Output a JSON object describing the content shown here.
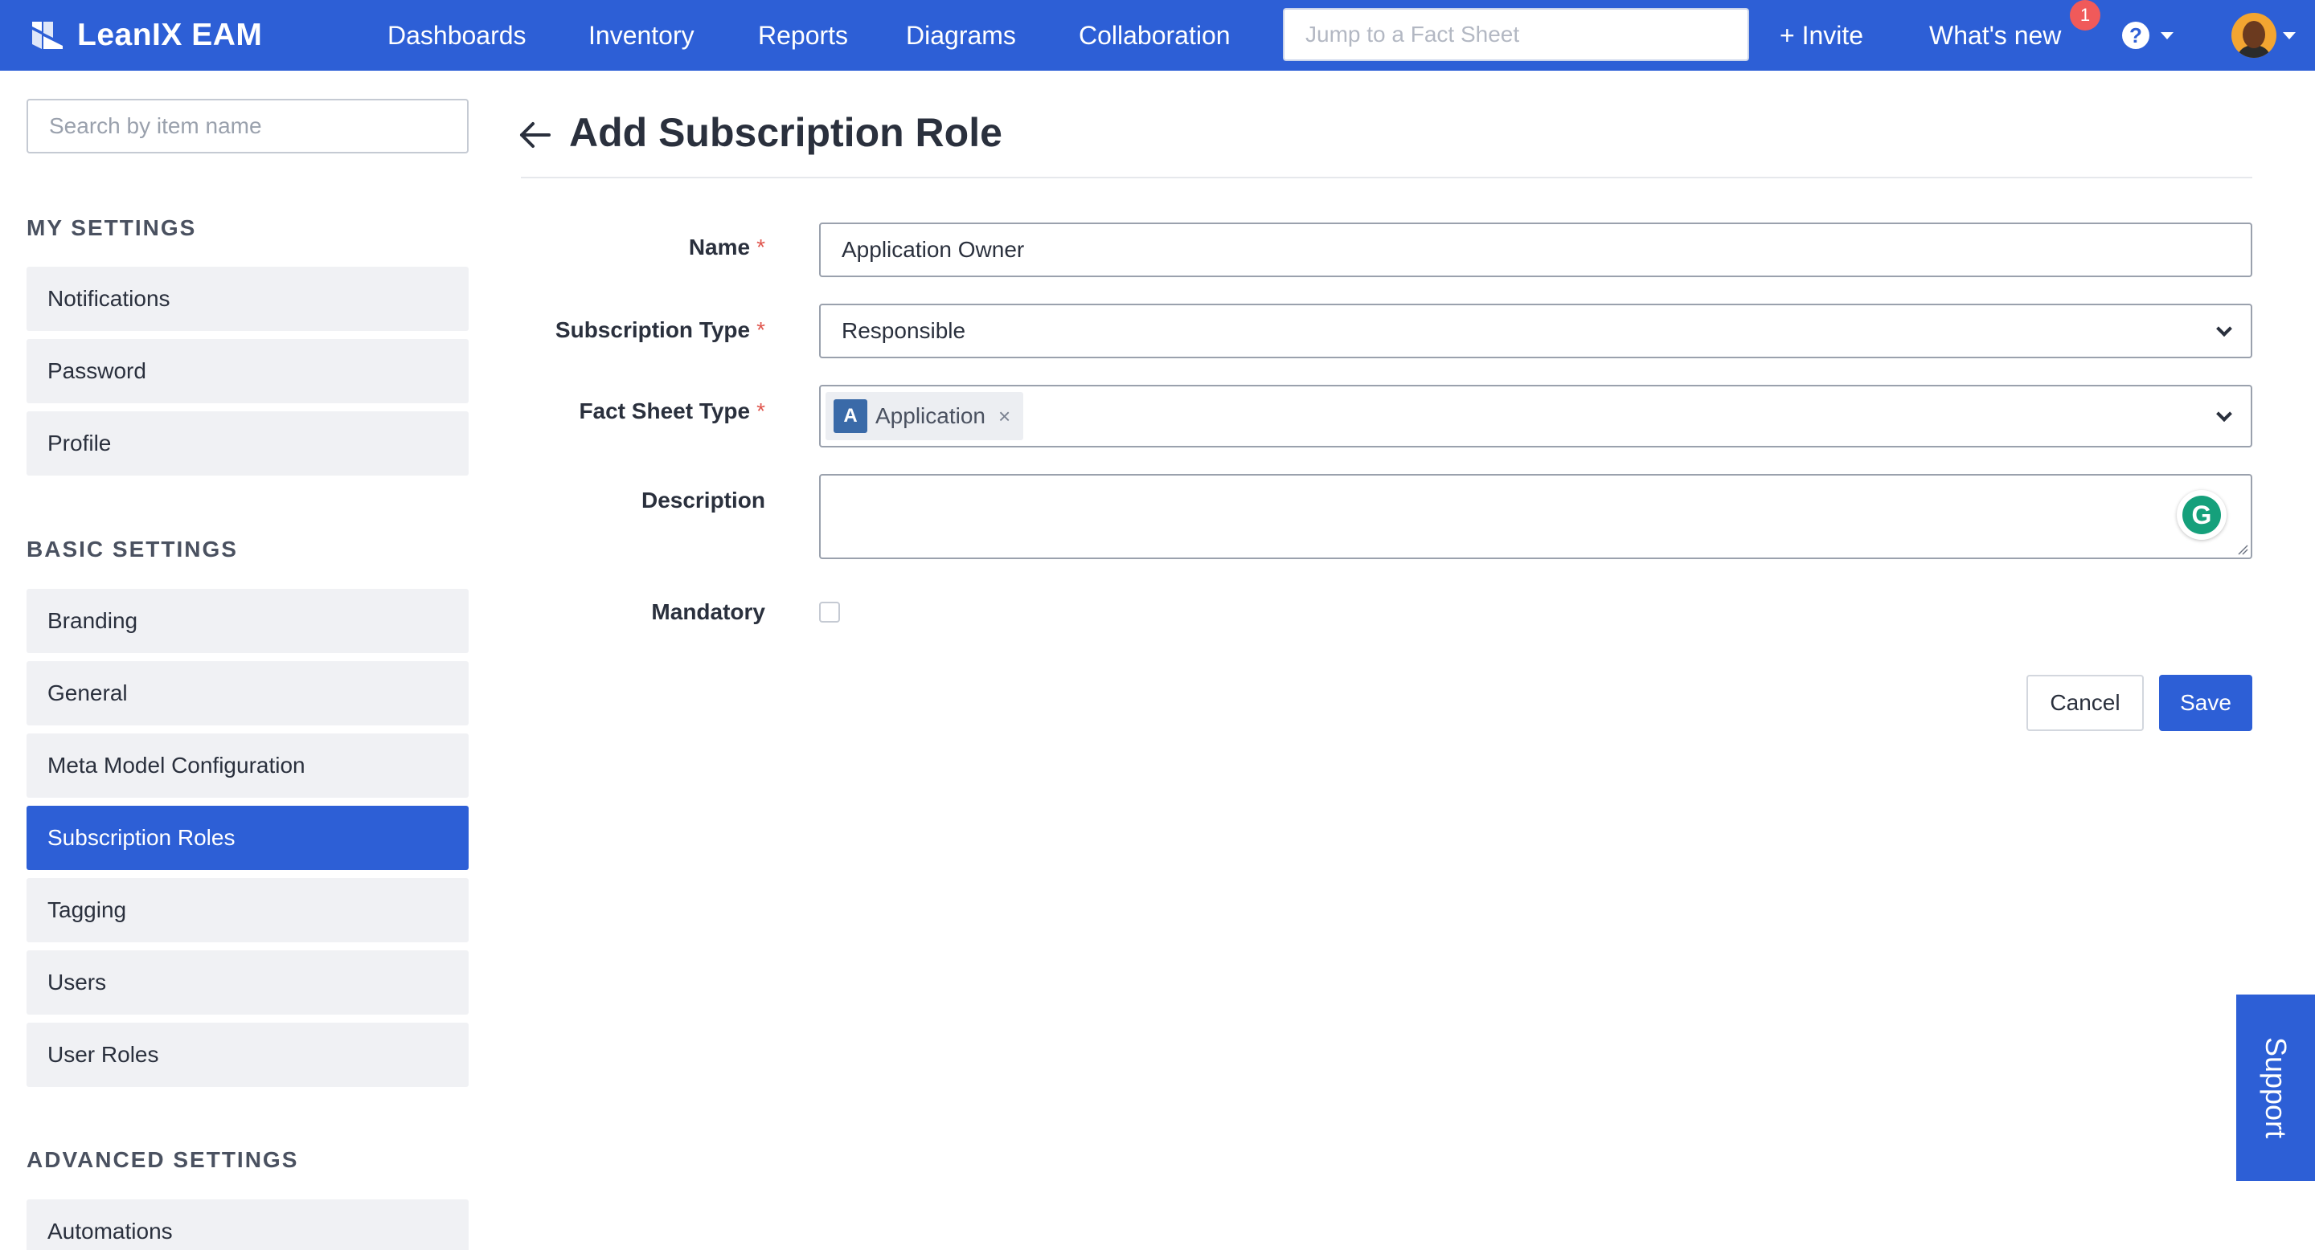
{
  "app": {
    "name": "LeanIX EAM"
  },
  "topnav": {
    "items": [
      "Dashboards",
      "Inventory",
      "Reports",
      "Diagrams",
      "Collaboration"
    ],
    "jump_placeholder": "Jump to a Fact Sheet",
    "invite_label": "+ Invite",
    "whats_new_label": "What's new",
    "whats_new_count": "1",
    "help_icon": "?"
  },
  "sidebar": {
    "search_placeholder": "Search by item name",
    "sections": [
      {
        "title": "MY SETTINGS",
        "items": [
          "Notifications",
          "Password",
          "Profile"
        ]
      },
      {
        "title": "BASIC SETTINGS",
        "items": [
          "Branding",
          "General",
          "Meta Model Configuration",
          "Subscription Roles",
          "Tagging",
          "Users",
          "User Roles"
        ]
      },
      {
        "title": "ADVANCED SETTINGS",
        "items": [
          "Automations"
        ]
      }
    ],
    "active_item": "Subscription Roles"
  },
  "page": {
    "title": "Add Subscription Role"
  },
  "form": {
    "name_label": "Name",
    "name_value": "Application Owner",
    "subscription_type_label": "Subscription Type",
    "subscription_type_value": "Responsible",
    "fact_sheet_type_label": "Fact Sheet Type",
    "fact_sheet_type_tag_letter": "A",
    "fact_sheet_type_tag_label": "Application",
    "fact_sheet_type_tag_remove": "×",
    "description_label": "Description",
    "description_value": "",
    "grammarly_letter": "G",
    "mandatory_label": "Mandatory",
    "mandatory_checked": false,
    "required_mark": "*"
  },
  "actions": {
    "cancel_label": "Cancel",
    "save_label": "Save"
  },
  "support": {
    "label": "Support"
  },
  "colors": {
    "brand": "#2d5fd6",
    "required": "#e0574f",
    "tag_badge": "#3a6aa8",
    "notification_badge": "#f05a5a",
    "grammarly": "#15a07b"
  }
}
